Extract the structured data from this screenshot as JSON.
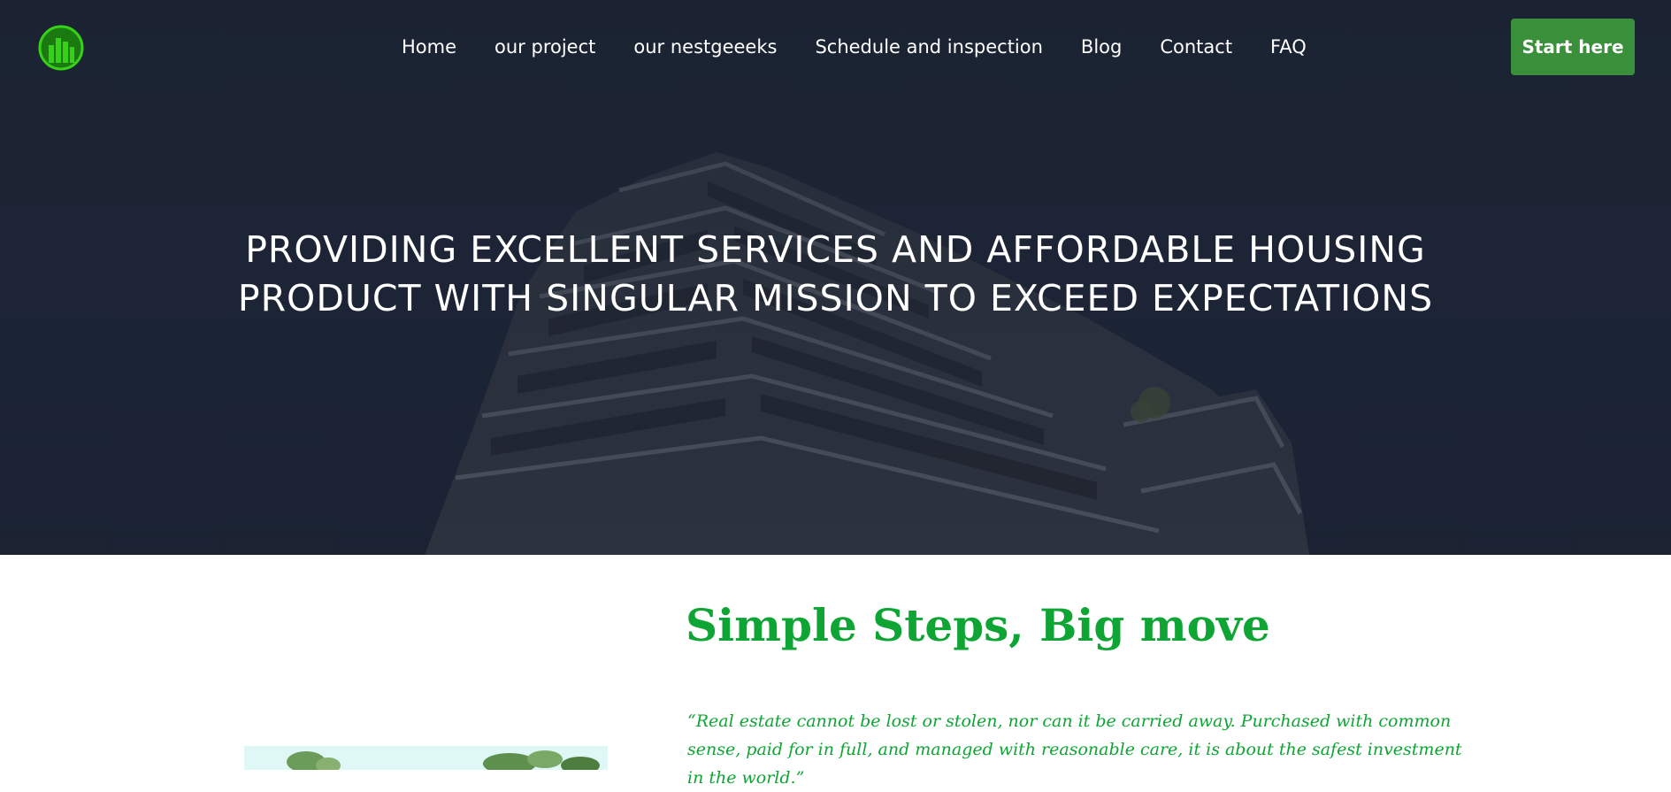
{
  "header": {
    "logo_icon": "green-building-circle-icon",
    "nav": [
      {
        "label": "Home"
      },
      {
        "label": "our project"
      },
      {
        "label": "our nestgeeeks"
      },
      {
        "label": "Schedule and inspection"
      },
      {
        "label": "Blog"
      },
      {
        "label": "Contact"
      },
      {
        "label": "FAQ"
      }
    ],
    "cta_label": "Start here"
  },
  "hero": {
    "title_line1": "PROVIDING EXCELLENT SERVICES AND AFFORDABLE HOUSING",
    "title_line2": "PRODUCT WITH SINGULAR MISSION TO EXCEED EXPECTATIONS"
  },
  "section": {
    "title": "Simple Steps, Big move",
    "quote": "“Real estate cannot be lost or stolen, nor can it be carried away. Purchased with common sense, paid for in full, and managed with reasonable care, it is about the safest investment in the world.”"
  },
  "colors": {
    "accent_green": "#0ea534",
    "button_green": "#3a8f3a",
    "hero_navy": "#1c2433"
  }
}
